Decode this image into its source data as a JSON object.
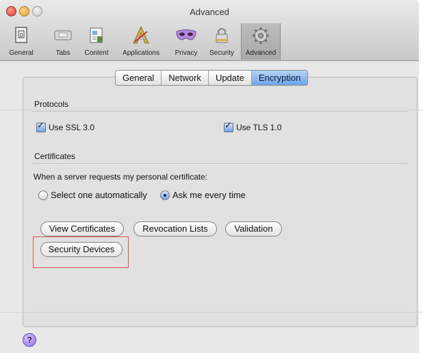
{
  "window": {
    "title": "Advanced"
  },
  "toolbar": {
    "items": [
      {
        "label": "General",
        "icon": "general-icon"
      },
      {
        "label": "Tabs",
        "icon": "tabs-icon"
      },
      {
        "label": "Content",
        "icon": "content-icon"
      },
      {
        "label": "Applications",
        "icon": "applications-icon"
      },
      {
        "label": "Privacy",
        "icon": "privacy-icon"
      },
      {
        "label": "Security",
        "icon": "security-icon"
      },
      {
        "label": "Advanced",
        "icon": "advanced-gear-icon",
        "selected": true
      }
    ]
  },
  "tabs": [
    {
      "label": "General"
    },
    {
      "label": "Network"
    },
    {
      "label": "Update"
    },
    {
      "label": "Encryption",
      "active": true
    }
  ],
  "protocols": {
    "title": "Protocols",
    "ssl": {
      "label": "Use SSL 3.0",
      "checked": true
    },
    "tls": {
      "label": "Use TLS 1.0",
      "checked": true
    }
  },
  "certificates": {
    "title": "Certificates",
    "prompt": "When a server requests my personal certificate:",
    "option_auto": "Select one automatically",
    "option_ask": "Ask me every time",
    "selected_option": "Ask me every time",
    "buttons": {
      "view": "View Certificates",
      "revocation": "Revocation Lists",
      "validation": "Validation",
      "devices": "Security Devices"
    }
  },
  "help": {
    "symbol": "?"
  },
  "colors": {
    "accent_blue": "#6ea6eb",
    "highlight_red": "#d9534f"
  }
}
